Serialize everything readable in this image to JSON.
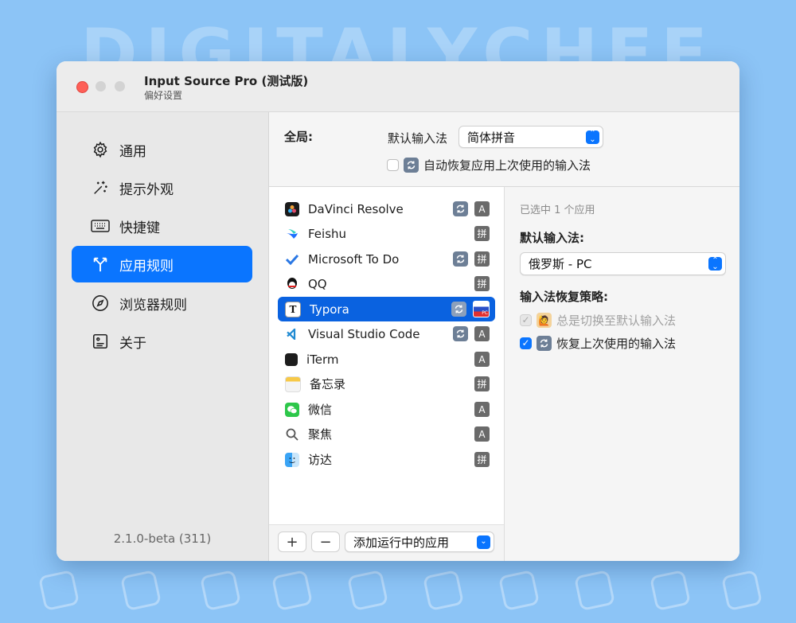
{
  "background": {
    "watermark": "DIGITALYCHEE"
  },
  "window": {
    "title": "Input Source Pro (测试版)",
    "subtitle": "偏好设置"
  },
  "sidebar": {
    "items": [
      {
        "label": "通用",
        "icon": "gear-icon",
        "active": false
      },
      {
        "label": "提示外观",
        "icon": "sparkles-icon",
        "active": false
      },
      {
        "label": "快捷键",
        "icon": "keyboard-icon",
        "active": false
      },
      {
        "label": "应用规则",
        "icon": "branch-icon",
        "active": true
      },
      {
        "label": "浏览器规则",
        "icon": "compass-icon",
        "active": false
      },
      {
        "label": "关于",
        "icon": "info-card-icon",
        "active": false
      }
    ],
    "version": "2.1.0-beta (311)"
  },
  "global": {
    "label": "全局:",
    "default_ime_label": "默认输入法",
    "default_ime_value": "简体拼音",
    "auto_restore_label": "自动恢复应用上次使用的输入法",
    "auto_restore_checked": false
  },
  "apps": [
    {
      "name": "DaVinci Resolve",
      "icon": "davinci-icon",
      "restore": true,
      "ime": "A"
    },
    {
      "name": "Feishu",
      "icon": "feishu-icon",
      "restore": false,
      "ime": "拼"
    },
    {
      "name": "Microsoft To Do",
      "icon": "todo-icon",
      "restore": true,
      "ime": "拼"
    },
    {
      "name": "QQ",
      "icon": "qq-icon",
      "restore": false,
      "ime": "拼"
    },
    {
      "name": "Typora",
      "icon": "typora-icon",
      "restore": true,
      "ime": "PC",
      "selected": true
    },
    {
      "name": "Visual Studio Code",
      "icon": "vscode-icon",
      "restore": true,
      "ime": "A"
    },
    {
      "name": "iTerm",
      "icon": "iterm-icon",
      "restore": false,
      "ime": "A"
    },
    {
      "name": "备忘录",
      "icon": "notes-icon",
      "restore": false,
      "ime": "拼"
    },
    {
      "name": "微信",
      "icon": "wechat-icon",
      "restore": false,
      "ime": "A"
    },
    {
      "name": "聚焦",
      "icon": "spotlight-icon",
      "restore": false,
      "ime": "A"
    },
    {
      "name": "访达",
      "icon": "finder-icon",
      "restore": false,
      "ime": "拼"
    }
  ],
  "list_toolbar": {
    "add_label": "+",
    "remove_label": "−",
    "add_running_label": "添加运行中的应用"
  },
  "detail": {
    "selection_note": "已选中 1 个应用",
    "default_ime_heading": "默认输入法:",
    "default_ime_value": "俄罗斯 - PC",
    "restore_heading": "输入法恢复策略:",
    "option_always_default": "总是切换至默认输入法",
    "option_restore_last": "恢复上次使用的输入法"
  },
  "colors": {
    "accent": "#0a75ff",
    "background": "#8cc4f6"
  }
}
